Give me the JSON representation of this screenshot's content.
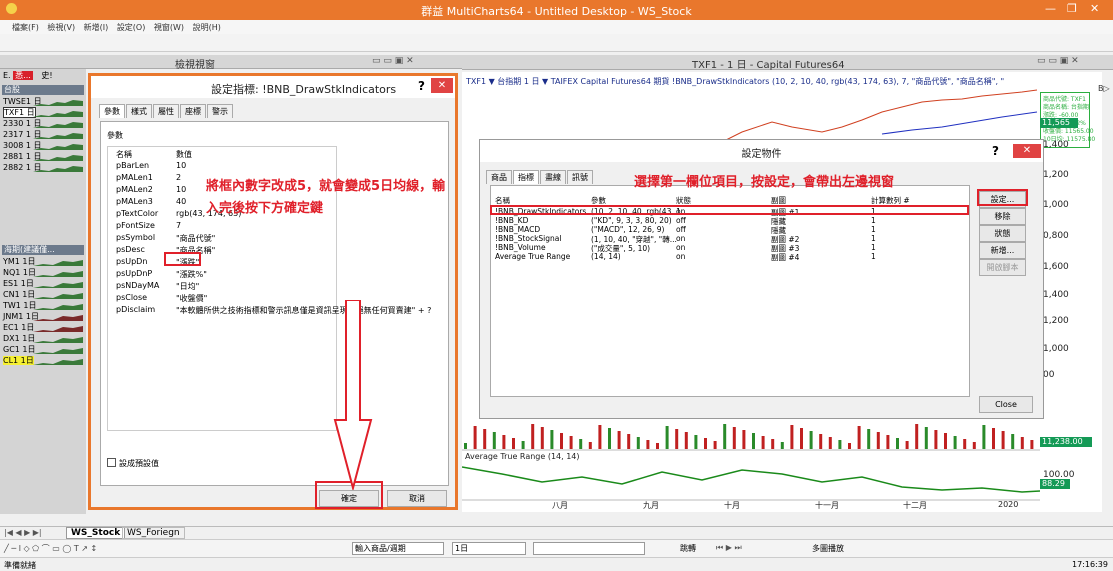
{
  "app": {
    "title": "群益 MultiCharts64 - Untitled Desktop - WS_Stock"
  },
  "menu": [
    "檔案(F)",
    "檢視(V)",
    "新增(I)",
    "設定(O)",
    "視窗(W)",
    "說明(H)"
  ],
  "left_window": {
    "title": "檢視視窗"
  },
  "quote_list": {
    "top_labels": [
      "E.",
      "悉...",
      "史!"
    ],
    "group1": "台股",
    "items1": [
      "TWSE1 日",
      "TXF1 日",
      "2330 1 日",
      "2317 1 日",
      "3008 1 日",
      "2881 1 日",
      "2882 1 日"
    ],
    "group2": "海期(建議僅...",
    "items2": [
      "YM1 1日",
      "NQ1 1日",
      "ES1 1日",
      "CN1 1日",
      "TW1 1日",
      "JNM1 1日",
      "EC1 1日",
      "DX1 1日",
      "GC1 1日",
      "CL1 1日"
    ]
  },
  "param_dialog": {
    "title": "設定指標: !BNB_DrawStkIndicators",
    "help": "?",
    "tabs": [
      "參數",
      "樣式",
      "屬性",
      "座標",
      "警示"
    ],
    "section": "參數",
    "col_name": "名稱",
    "col_value": "數值",
    "params": [
      {
        "n": "pBarLen",
        "v": "10"
      },
      {
        "n": "pMALen1",
        "v": "2"
      },
      {
        "n": "pMALen2",
        "v": "10"
      },
      {
        "n": "pMALen3",
        "v": "40"
      },
      {
        "n": "pTextColor",
        "v": "rgb(43, 174, 63)"
      },
      {
        "n": "pFontSize",
        "v": "7"
      },
      {
        "n": "psSymbol",
        "v": "\"商品代號\""
      },
      {
        "n": "psDesc",
        "v": "\"商品名稱\""
      },
      {
        "n": "psUpDn",
        "v": "\"漲跌\""
      },
      {
        "n": "psUpDnP",
        "v": "\"漲跌%\""
      },
      {
        "n": "psNDayMA",
        "v": "\"日均\""
      },
      {
        "n": "psClose",
        "v": "\"收盤價\""
      },
      {
        "n": "pDisclaim",
        "v": "\"本軟體所供之技術指標和警示訊息僅是資訊呈現，絕無任何買賣建\" + ?"
      }
    ],
    "default_label": "設成預設值",
    "ok": "確定",
    "cancel": "取消"
  },
  "annotation1": "將框內數字改成5，就會變成5日均線，輸入完後按下方確定鍵",
  "chart_window": {
    "title": "TXF1 - 1 日 - Capital Futures64",
    "info": "TXF1 ▼  台指期  1 日 ▼  TAIFEX  Capital Futures64  期貨  !BNB_DrawStkIndicators  (10, 2, 10, 40, rgb(43, 174, 63), 7, \"商品代號\", \"商品名稱\", \"",
    "legend": [
      "商品代號: TXF1",
      "商品名稱: 台指期",
      "漲跌: -60.00",
      "漲跌%: -0.52%",
      "收盤價: 11565.00",
      "10日均: 11575.80"
    ],
    "scale": [
      "11,600",
      "1,400",
      "1,200",
      "1,000",
      "0,800",
      "1,600",
      "1,400",
      "1,200",
      "1,000",
      "00"
    ],
    "price_badge": "11,565",
    "vol_badge": "11,238.00",
    "atr_label": "Average True Range  (14, 14)",
    "atr_badge": "88.29",
    "atr_top": "100.00",
    "months": [
      "八月",
      "九月",
      "十月",
      "十一月",
      "十二月",
      "2020"
    ],
    "side": "B▷"
  },
  "obj_dialog": {
    "title": "設定物件",
    "help": "?",
    "tabs": [
      "商品",
      "指標",
      "畫線",
      "訊號"
    ],
    "headers": [
      "名稱",
      "參數",
      "狀態",
      "副圖",
      "計算數列 #"
    ],
    "rows": [
      [
        "!BNB_DrawStkIndicators",
        "(10, 2, 10, 40, rgb(43, 1...",
        "on",
        "副圖 #1",
        "1"
      ],
      [
        "!BNB_KD",
        "(\"KD\", 9, 3, 3, 80, 20)",
        "off",
        "隱藏",
        "1"
      ],
      [
        "!BNB_MACD",
        "(\"MACD\", 12, 26, 9)",
        "off",
        "隱藏",
        "1"
      ],
      [
        "!BNB_StockSignal",
        "(1, 10, 40, \"穿越\", \"轉...",
        "on",
        "副圖 #2",
        "1"
      ],
      [
        "!BNB_Volume",
        "(\"成交量\", 5, 10)",
        "on",
        "副圖 #3",
        "1"
      ],
      [
        "Average True Range",
        "(14, 14)",
        "on",
        "副圖 #4",
        "1"
      ]
    ],
    "buttons": [
      "設定...",
      "移除",
      "狀態",
      "新增...",
      "開啟腳本"
    ],
    "close": "Close"
  },
  "annotation2": "選擇第一欄位項目，按設定，會帶出左邊視窗",
  "sheets": [
    "WS_Stock",
    "WS_Foriegn"
  ],
  "drawbar": {
    "input_label": "輸入商品/週期",
    "interval": "1日",
    "jump": "跳轉",
    "multi": "多圖播放"
  },
  "status": {
    "left": "準備就緒",
    "time": "17:16:39"
  }
}
